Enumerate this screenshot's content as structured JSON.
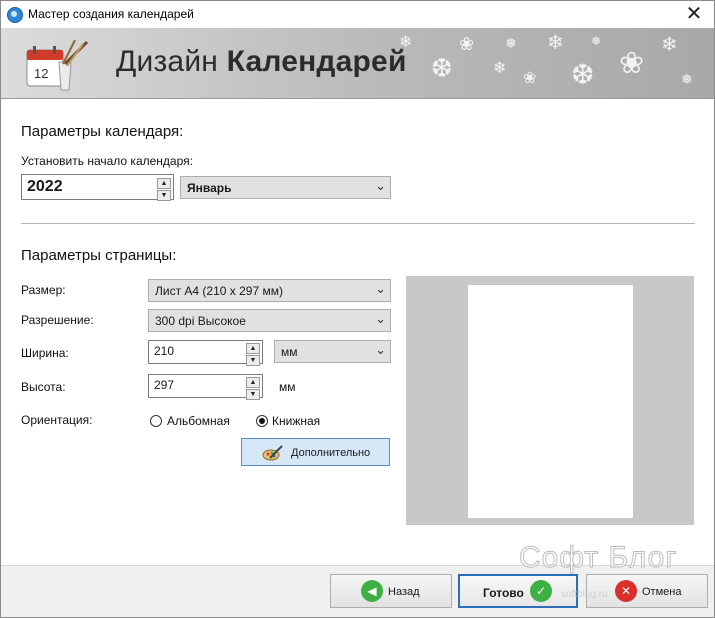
{
  "window": {
    "title": "Мастер создания календарей"
  },
  "banner": {
    "title_light": "Дизайн ",
    "title_bold": "Календарей"
  },
  "calendar": {
    "section_title": "Параметры календаря:",
    "start_label": "Установить начало календаря:",
    "year": "2022",
    "month": "Январь"
  },
  "page": {
    "section_title": "Параметры страницы:",
    "size_label": "Размер:",
    "size_value": "Лист A4 (210 x 297 мм)",
    "resolution_label": "Разрешение:",
    "resolution_value": "300 dpi Высокое",
    "width_label": "Ширина:",
    "width_value": "210",
    "width_unit": "мм",
    "height_label": "Высота:",
    "height_value": "297",
    "height_unit": "мм",
    "orientation_label": "Ориентация:",
    "orientation_landscape": "Альбомная",
    "orientation_portrait": "Книжная",
    "orientation_selected": "portrait",
    "advanced_button": "Дополнительно"
  },
  "footer": {
    "back_button": "Назад",
    "done_button": "Готово",
    "cancel_button": "Отмена"
  },
  "watermark": {
    "text": "Софт Блог",
    "sub": "softblog.ru"
  },
  "icons": {
    "title": "app-icon",
    "close": "close-icon",
    "banner": "calendar-paintbrush-icon",
    "spin_up": "spin-up-icon",
    "spin_down": "spin-down-icon",
    "dropdown": "chevron-down-icon",
    "advanced": "settings-brush-icon",
    "back": "arrow-left-icon",
    "done": "checkmark-icon",
    "cancel": "cancel-x-icon"
  },
  "colors": {
    "back_icon": "#3cb043",
    "done_icon": "#3cb043",
    "cancel_icon": "#d9302c",
    "done_border": "#2f6db5",
    "advanced_bg": "#d6e8f8"
  }
}
